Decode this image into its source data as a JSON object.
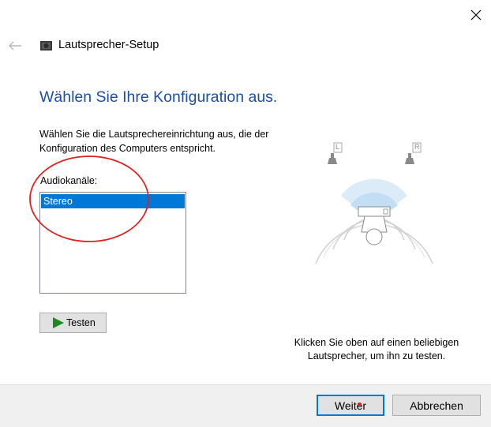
{
  "window": {
    "title": "Lautsprecher-Setup",
    "close_glyph": "✕",
    "back_glyph": "←"
  },
  "content": {
    "heading": "Wählen Sie Ihre Konfiguration aus.",
    "description": "Wählen Sie die Lautsprechereinrichtung aus, die der Konfiguration des Computers entspricht.",
    "channels_label": "Audiokanäle:",
    "channels": [
      {
        "label": "Stereo",
        "selected": true
      }
    ],
    "test_button": "Testen",
    "hint": "Klicken Sie oben auf einen beliebigen Lautsprecher, um ihn zu testen.",
    "speaker_labels": {
      "left": "L",
      "right": "R"
    }
  },
  "footer": {
    "next_button": "Weiter",
    "cancel_button": "Abbrechen"
  },
  "icons": {
    "back": "back-arrow-icon",
    "close": "close-icon",
    "app": "speaker-setup-icon",
    "play": "play-icon",
    "speaker": "speaker-icon"
  },
  "colors": {
    "heading": "#1e4fa0",
    "selection": "#0078d7",
    "default_button_border": "#0078d7",
    "annotation_circle": "#e02020",
    "play_icon": "#1e8a1e",
    "footer_bg": "#f0f0f0"
  }
}
